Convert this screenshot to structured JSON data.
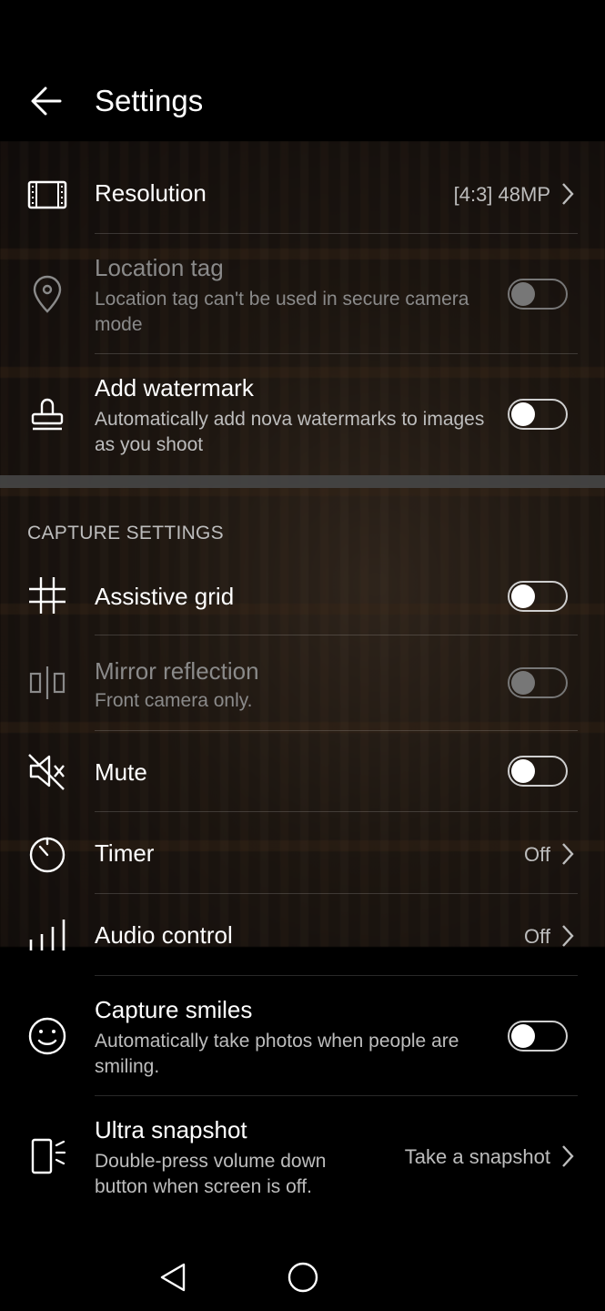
{
  "header": {
    "title": "Settings"
  },
  "rows": {
    "resolution": {
      "label": "Resolution",
      "value": "[4:3] 48MP"
    },
    "location_tag": {
      "label": "Location tag",
      "sub": "Location tag can't be used in secure camera mode",
      "toggle_on": false,
      "enabled": false
    },
    "watermark": {
      "label": "Add watermark",
      "sub": "Automatically add nova watermarks to images as you shoot",
      "toggle_on": false
    },
    "assistive_grid": {
      "label": "Assistive grid",
      "toggle_on": false
    },
    "mirror": {
      "label": "Mirror reflection",
      "sub": "Front camera only.",
      "toggle_on": false,
      "enabled": false
    },
    "mute": {
      "label": "Mute",
      "toggle_on": false
    },
    "timer": {
      "label": "Timer",
      "value": "Off"
    },
    "audio_control": {
      "label": "Audio control",
      "value": "Off"
    },
    "capture_smiles": {
      "label": "Capture smiles",
      "sub": "Automatically take photos when people are smiling.",
      "toggle_on": false
    },
    "ultra_snapshot": {
      "label": "Ultra snapshot",
      "sub": "Double-press volume down button when screen is off.",
      "value": "Take a snapshot"
    }
  },
  "section": {
    "capture_title": "CAPTURE SETTINGS"
  },
  "icons": {
    "back": "arrow-left-icon",
    "resolution": "film-frame-icon",
    "location": "location-pin-icon",
    "watermark": "stamp-icon",
    "grid": "grid-icon",
    "mirror": "mirror-icon",
    "mute": "speaker-muted-icon",
    "timer": "timer-icon",
    "audio": "audio-bars-icon",
    "smile": "smile-icon",
    "snapshot": "phone-snapshot-icon",
    "nav_back": "triangle-back-icon",
    "nav_home": "circle-home-icon"
  },
  "colors": {
    "background": "#000000",
    "text_primary": "#ffffff",
    "text_secondary": "#bdbdbd",
    "text_disabled": "#8a8a8a"
  }
}
